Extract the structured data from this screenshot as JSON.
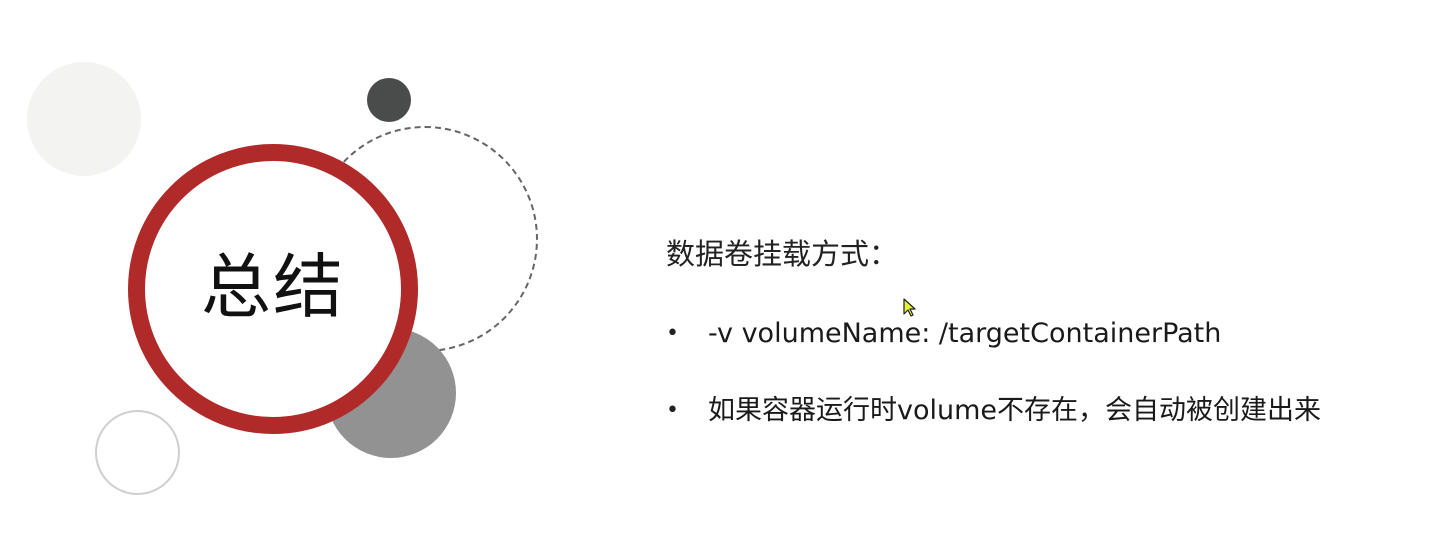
{
  "slide": {
    "title": "总结",
    "heading": "数据卷挂载方式：",
    "bullets": [
      {
        "marker": "•",
        "text": "-v volumeName: /targetContainerPath"
      },
      {
        "marker": "•",
        "text": "如果容器运行时volume不存在，会自动被创建出来"
      }
    ]
  },
  "colors": {
    "accent_red": "#b02a2a",
    "dark_grey": "#4a4b4b",
    "mid_grey": "#929292",
    "light_grey": "#f3f3f1",
    "cursor_yellow": "#e8f23a"
  },
  "icons": {
    "cursor": "mouse-pointer-icon"
  }
}
